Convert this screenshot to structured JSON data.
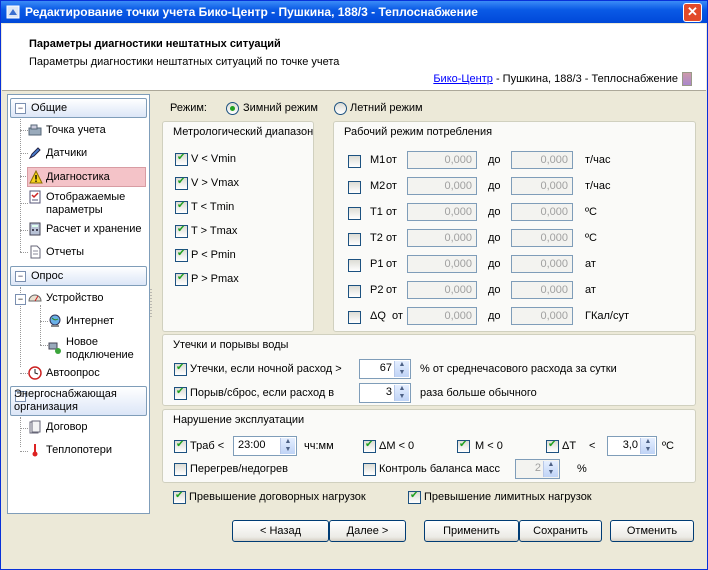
{
  "window": {
    "title": "Редактирование точки учета Бико-Центр - Пушкина, 188/3 - Теплоснабжение",
    "close_glyph": "✕"
  },
  "header": {
    "title": "Параметры диагностики нештатных ситуаций",
    "subtitle": "Параметры диагностики нештатных ситуаций по точке учета",
    "crumb_link": "Бико-Центр",
    "crumb_rest": " - Пушкина, 188/3 - Теплоснабжение"
  },
  "sidebar": {
    "groups": [
      {
        "label": "Общие",
        "toggle": "−"
      },
      {
        "label": "Опрос",
        "toggle": "−"
      },
      {
        "label": "Энергоснабжающая организация",
        "toggle": "−"
      }
    ],
    "items": [
      {
        "label": "Точка учета",
        "icon": "meter-point-icon"
      },
      {
        "label": "Датчики",
        "icon": "pencil-icon"
      },
      {
        "label": "Диагностика",
        "icon": "warning-icon"
      },
      {
        "label": "Отображаемые параметры",
        "icon": "checklist-icon"
      },
      {
        "label": "Расчет и хранение",
        "icon": "calculator-icon"
      },
      {
        "label": "Отчеты",
        "icon": "document-icon"
      },
      {
        "label": "Устройство",
        "icon": "gauge-icon"
      },
      {
        "label": "Интернет",
        "icon": "globe-icon"
      },
      {
        "label": "Новое подключение",
        "icon": "network-icon"
      },
      {
        "label": "Автоопрос",
        "icon": "clock-icon"
      },
      {
        "label": "Договор",
        "icon": "contract-icon"
      },
      {
        "label": "Теплопотери",
        "icon": "thermometer-icon"
      }
    ],
    "tree_toggle": "−"
  },
  "mode": {
    "label": "Режим:",
    "winter": "Зимний режим",
    "summer": "Летний режим",
    "selected": "winter"
  },
  "metro": {
    "title": "Метрологический диапазон",
    "items": [
      "V < Vmin",
      "V > Vmax",
      "T < Tmin",
      "T > Tmax",
      "P < Pmin",
      "P > Pmax"
    ]
  },
  "work": {
    "title": "Рабочий режим потребления",
    "from_label": "от",
    "to_label": "до",
    "rows": [
      {
        "name": "M1",
        "from": "0,000",
        "to": "0,000",
        "unit": "т/час"
      },
      {
        "name": "M2",
        "from": "0,000",
        "to": "0,000",
        "unit": "т/час"
      },
      {
        "name": "T1",
        "from": "0,000",
        "to": "0,000",
        "unit": "ºC"
      },
      {
        "name": "T2",
        "from": "0,000",
        "to": "0,000",
        "unit": "ºC"
      },
      {
        "name": "P1",
        "from": "0,000",
        "to": "0,000",
        "unit": "ат"
      },
      {
        "name": "P2",
        "from": "0,000",
        "to": "0,000",
        "unit": "ат"
      },
      {
        "name": "ΔQ",
        "from": "0,000",
        "to": "0,000",
        "unit": "ГКал/сут"
      }
    ]
  },
  "leaks": {
    "title": "Утечки и порывы воды",
    "leak_label": "Утечки, если ночной расход >",
    "leak_value": "67",
    "leak_suffix": "% от среднечасового расхода за сутки",
    "burst_label": "Порыв/сброс, если расход в",
    "burst_value": "3",
    "burst_suffix": "раза больше обычного"
  },
  "violations": {
    "title": "Нарушение эксплуатации",
    "traб_label": "Траб <",
    "traб_value": "23:00",
    "traб_unit": "чч:мм",
    "dm_label": "ΔM < 0",
    "m_label": "M  < 0",
    "dt_label": "ΔT",
    "dt_lt": "<",
    "dt_value": "3,0",
    "dt_unit": "ºC",
    "overheat_label": "Перегрев/недогрев",
    "balance_label": "Контроль баланса масс",
    "balance_value": "2",
    "balance_unit": "%"
  },
  "bottom_checks": {
    "contract": "Превышение договорных нагрузок",
    "limit": "Превышение лимитных нагрузок"
  },
  "buttons": {
    "back": "< Назад",
    "next": "Далее >",
    "apply": "Применить",
    "save": "Сохранить",
    "cancel": "Отменить"
  },
  "spin_glyphs": {
    "up": "▲",
    "down": "▼"
  }
}
